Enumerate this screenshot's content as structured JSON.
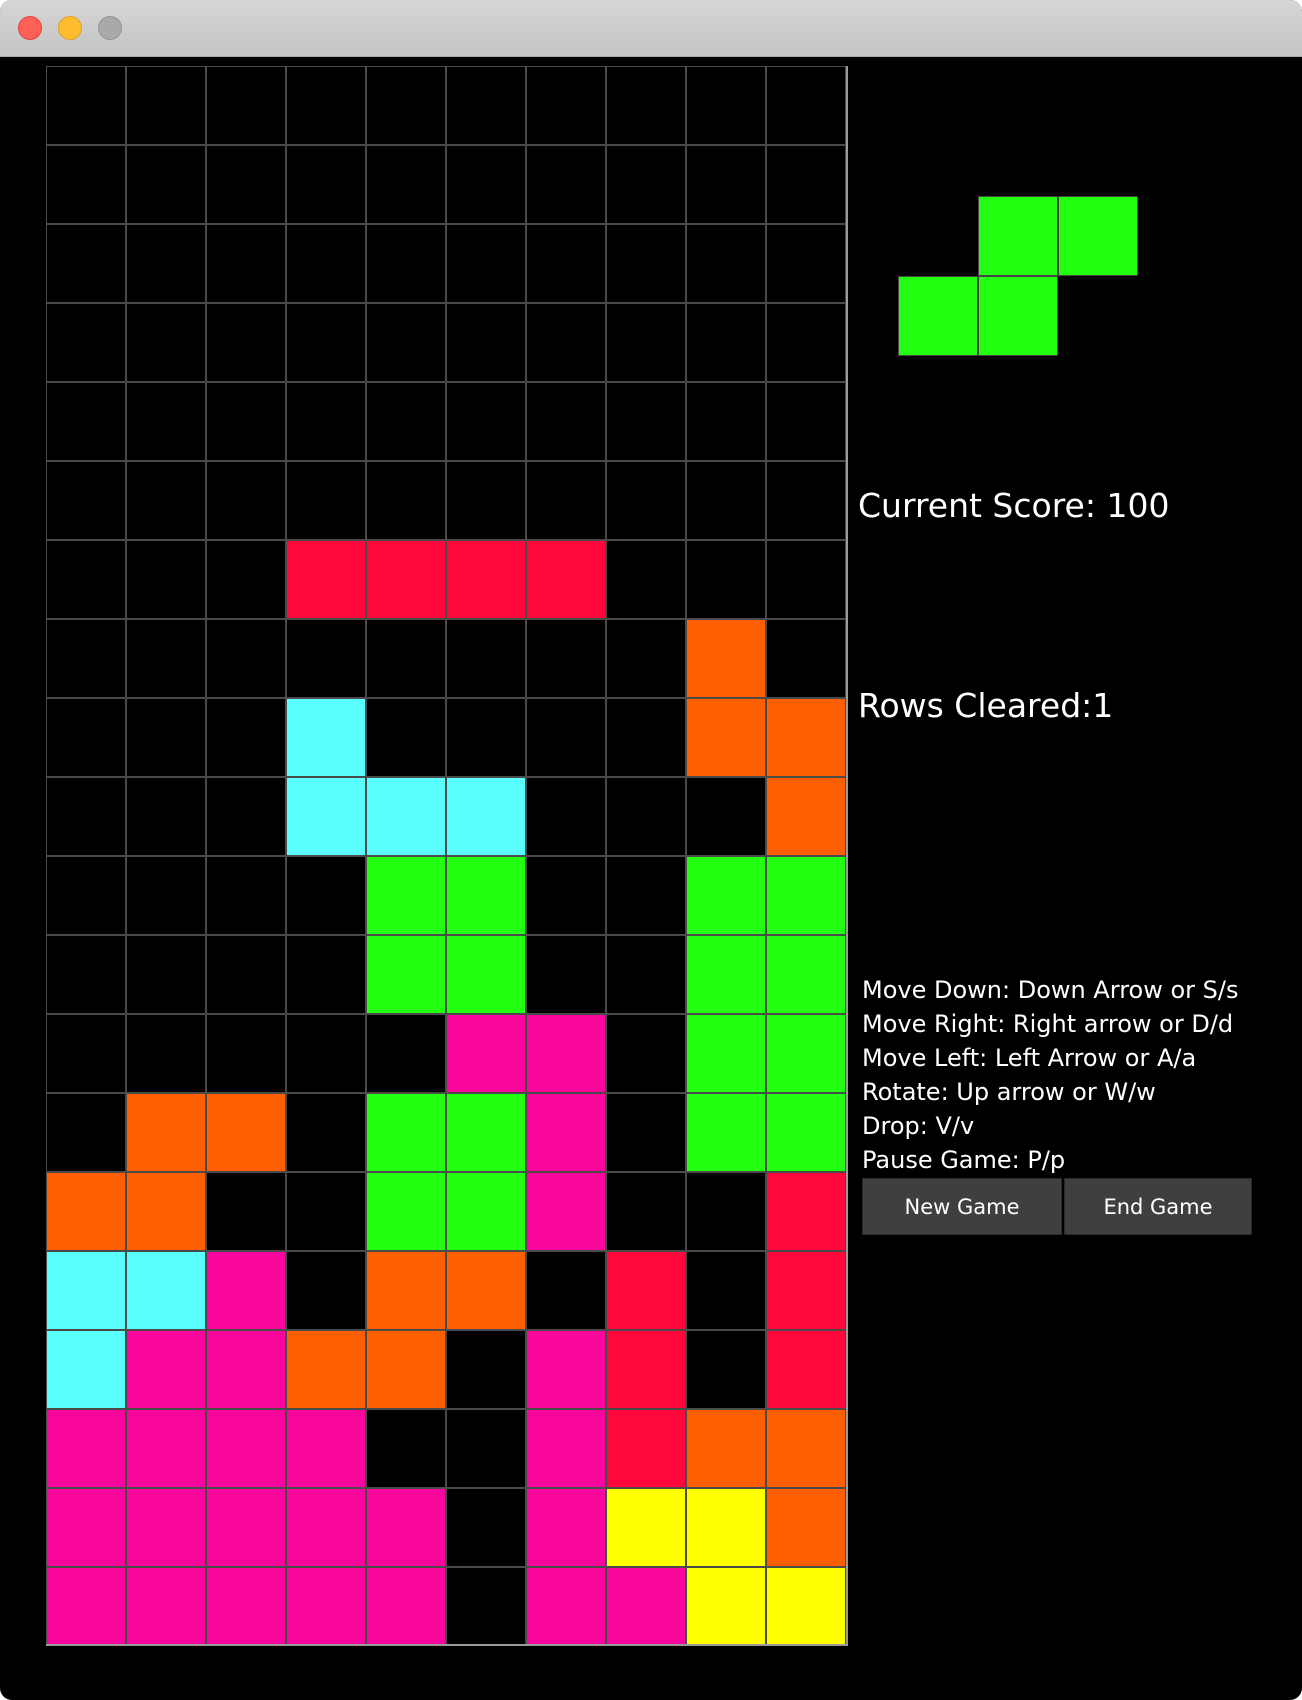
{
  "window": {
    "controls": [
      "close",
      "minimize",
      "maximize"
    ]
  },
  "board": {
    "columns": 10,
    "rows": 20,
    "colors": {
      "R": "#ff073a",
      "O": "#ff5f00",
      "C": "#59ffff",
      "G": "#22ff11",
      "M": "#f9069d",
      "Y": "#ffff00",
      ".": "#000000"
    },
    "grid": [
      "..........",
      "..........",
      "..........",
      "..........",
      "..........",
      "..........",
      "...RRRR...",
      "........O.",
      "...C....OO",
      "...CCC...O",
      "....GG..GG",
      "....GG..GG",
      ".....MM.GG",
      ".OO.GGM.GG",
      "OO..GGM..R",
      "CCM.OO.R.R",
      "CMMOO.MR.R",
      "MMMM..MROO",
      "MMMMM.MYYO",
      "MMMMM.MMYY"
    ]
  },
  "next_piece": {
    "name": "S",
    "color": "#22ff11",
    "cells": [
      [
        0,
        1
      ],
      [
        0,
        2
      ],
      [
        1,
        0
      ],
      [
        1,
        1
      ]
    ]
  },
  "stats": {
    "score_text": "Current Score: 100",
    "rows_text": "Rows Cleared:1"
  },
  "help": [
    "Move Down: Down Arrow or S/s",
    "Move Right: Right arrow or D/d",
    "Move Left: Left Arrow or A/a",
    "Rotate: Up arrow or W/w",
    "Drop: V/v",
    "Pause Game: P/p"
  ],
  "buttons": {
    "new_game": "New Game",
    "end_game": "End Game"
  }
}
